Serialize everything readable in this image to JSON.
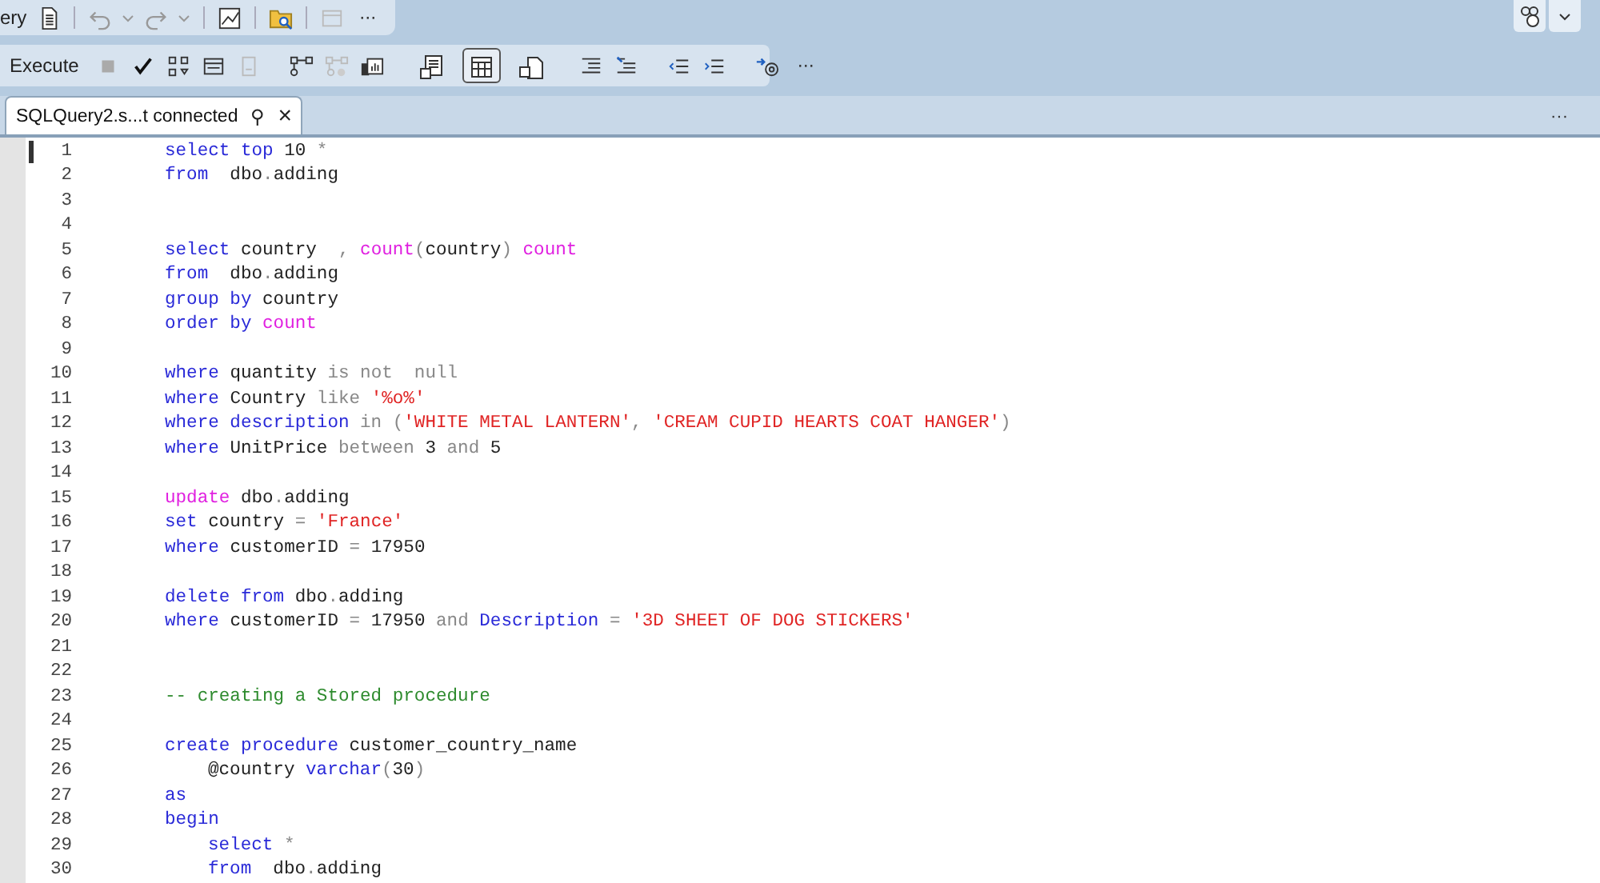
{
  "toolbar_top": {
    "cut_label": "ery",
    "more": "···"
  },
  "toolbar_main": {
    "execute": "Execute",
    "more": "···",
    "result_toggles": [
      {
        "selected": false
      },
      {
        "selected": true
      },
      {
        "selected": false
      }
    ]
  },
  "tab": {
    "title": "SQLQuery2.s...t connected",
    "pin": "⚲",
    "close": "×",
    "overflow": "···"
  },
  "editor": {
    "lines": [
      {
        "number": "1",
        "current": true,
        "tokens": [
          {
            "kind": "kw",
            "text": "select top "
          },
          {
            "kind": "plain",
            "text": "10 "
          },
          {
            "kind": "op",
            "text": "*"
          }
        ]
      },
      {
        "number": "2",
        "current": false,
        "tokens": [
          {
            "kind": "kw",
            "text": "from"
          },
          {
            "kind": "plain",
            "text": "  dbo"
          },
          {
            "kind": "op",
            "text": "."
          },
          {
            "kind": "plain",
            "text": "adding"
          }
        ]
      },
      {
        "number": "3",
        "current": false
      },
      {
        "number": "4",
        "current": false
      },
      {
        "number": "5",
        "current": false,
        "tokens": [
          {
            "kind": "kw",
            "text": "select "
          },
          {
            "kind": "plain",
            "text": "country  "
          },
          {
            "kind": "op",
            "text": ", "
          },
          {
            "kind": "fn",
            "text": "count"
          },
          {
            "kind": "op",
            "text": "("
          },
          {
            "kind": "plain",
            "text": "country"
          },
          {
            "kind": "op",
            "text": ") "
          },
          {
            "kind": "fn",
            "text": "count"
          }
        ]
      },
      {
        "number": "6",
        "current": false,
        "tokens": [
          {
            "kind": "kw",
            "text": "from"
          },
          {
            "kind": "plain",
            "text": "  dbo"
          },
          {
            "kind": "op",
            "text": "."
          },
          {
            "kind": "plain",
            "text": "adding"
          }
        ]
      },
      {
        "number": "7",
        "current": false,
        "tokens": [
          {
            "kind": "kw",
            "text": "group by "
          },
          {
            "kind": "plain",
            "text": "country"
          }
        ]
      },
      {
        "number": "8",
        "current": false,
        "tokens": [
          {
            "kind": "kw",
            "text": "order by "
          },
          {
            "kind": "fn",
            "text": "count"
          }
        ]
      },
      {
        "number": "9",
        "current": false
      },
      {
        "number": "10",
        "current": false,
        "tokens": [
          {
            "kind": "kw",
            "text": "where "
          },
          {
            "kind": "plain",
            "text": "quantity "
          },
          {
            "kind": "op",
            "text": "is not  null"
          }
        ]
      },
      {
        "number": "11",
        "current": false,
        "tokens": [
          {
            "kind": "kw",
            "text": "where "
          },
          {
            "kind": "plain",
            "text": "Country "
          },
          {
            "kind": "op",
            "text": "like "
          },
          {
            "kind": "str",
            "text": "'%o%'"
          }
        ]
      },
      {
        "number": "12",
        "current": false,
        "tokens": [
          {
            "kind": "kw",
            "text": "where description "
          },
          {
            "kind": "op",
            "text": "in ("
          },
          {
            "kind": "str",
            "text": "'WHITE METAL LANTERN'"
          },
          {
            "kind": "op",
            "text": ", "
          },
          {
            "kind": "str",
            "text": "'CREAM CUPID HEARTS COAT HANGER'"
          },
          {
            "kind": "op",
            "text": ")"
          }
        ]
      },
      {
        "number": "13",
        "current": false,
        "tokens": [
          {
            "kind": "kw",
            "text": "where "
          },
          {
            "kind": "plain",
            "text": "UnitPrice "
          },
          {
            "kind": "op",
            "text": "between "
          },
          {
            "kind": "plain",
            "text": "3 "
          },
          {
            "kind": "op",
            "text": "and "
          },
          {
            "kind": "plain",
            "text": "5"
          }
        ]
      },
      {
        "number": "14",
        "current": false
      },
      {
        "number": "15",
        "current": false,
        "tokens": [
          {
            "kind": "fn",
            "text": "update "
          },
          {
            "kind": "plain",
            "text": "dbo"
          },
          {
            "kind": "op",
            "text": "."
          },
          {
            "kind": "plain",
            "text": "adding"
          }
        ]
      },
      {
        "number": "16",
        "current": false,
        "tokens": [
          {
            "kind": "kw",
            "text": "set "
          },
          {
            "kind": "plain",
            "text": "country "
          },
          {
            "kind": "op",
            "text": "= "
          },
          {
            "kind": "str",
            "text": "'France'"
          }
        ]
      },
      {
        "number": "17",
        "current": false,
        "tokens": [
          {
            "kind": "kw",
            "text": "where "
          },
          {
            "kind": "plain",
            "text": "customerID "
          },
          {
            "kind": "op",
            "text": "= "
          },
          {
            "kind": "plain",
            "text": "17950"
          }
        ]
      },
      {
        "number": "18",
        "current": false
      },
      {
        "number": "19",
        "current": false,
        "tokens": [
          {
            "kind": "kw",
            "text": "delete from "
          },
          {
            "kind": "plain",
            "text": "dbo"
          },
          {
            "kind": "op",
            "text": "."
          },
          {
            "kind": "plain",
            "text": "adding"
          }
        ]
      },
      {
        "number": "20",
        "current": false,
        "tokens": [
          {
            "kind": "kw",
            "text": "where "
          },
          {
            "kind": "plain",
            "text": "customerID "
          },
          {
            "kind": "op",
            "text": "= "
          },
          {
            "kind": "plain",
            "text": "17950 "
          },
          {
            "kind": "op",
            "text": "and "
          },
          {
            "kind": "kw",
            "text": "Description "
          },
          {
            "kind": "op",
            "text": "= "
          },
          {
            "kind": "str",
            "text": "'3D SHEET OF DOG STICKERS'"
          }
        ]
      },
      {
        "number": "21",
        "current": false
      },
      {
        "number": "22",
        "current": false
      },
      {
        "number": "23",
        "current": false,
        "tokens": [
          {
            "kind": "cmt",
            "text": "-- creating a Stored procedure"
          }
        ]
      },
      {
        "number": "24",
        "current": false
      },
      {
        "number": "25",
        "current": false,
        "tokens": [
          {
            "kind": "kw",
            "text": "create procedure "
          },
          {
            "kind": "plain",
            "text": "customer_country_name"
          }
        ],
        "children": [
          {
            "number": "26",
            "current": false,
            "tokens": [
              {
                "kind": "plain",
                "text": "@country "
              },
              {
                "kind": "kw",
                "text": "varchar"
              },
              {
                "kind": "op",
                "text": "("
              },
              {
                "kind": "plain",
                "text": "30"
              },
              {
                "kind": "op",
                "text": ")"
              }
            ]
          }
        ]
      },
      {
        "number": "27",
        "current": false,
        "tokens": [
          {
            "kind": "kw",
            "text": "as"
          }
        ]
      },
      {
        "number": "28",
        "current": false,
        "tokens": [
          {
            "kind": "kw",
            "text": "begin"
          }
        ],
        "children": [
          {
            "number": "29",
            "current": false,
            "tokens": [
              {
                "kind": "kw",
                "text": "select "
              },
              {
                "kind": "op",
                "text": "*"
              }
            ]
          },
          {
            "number": "30",
            "current": false,
            "tokens": [
              {
                "kind": "kw",
                "text": "from"
              },
              {
                "kind": "plain",
                "text": "  dbo"
              },
              {
                "kind": "op",
                "text": "."
              },
              {
                "kind": "plain",
                "text": "adding"
              }
            ]
          }
        ]
      }
    ]
  }
}
